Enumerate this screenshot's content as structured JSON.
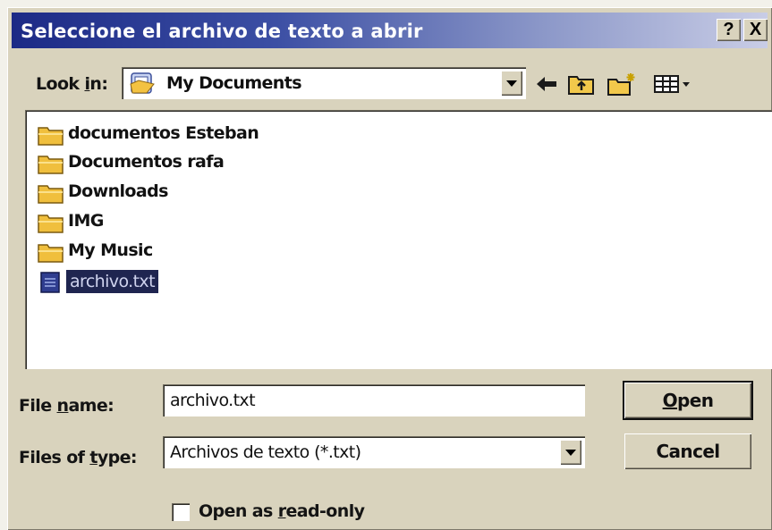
{
  "window": {
    "title": "Seleccione el archivo de texto a abrir",
    "help_button": "?",
    "close_button": "X"
  },
  "look_in": {
    "label_prefix": "Look ",
    "label_accel": "i",
    "label_suffix": "n:",
    "value": "My Documents",
    "icon": "my-documents-icon"
  },
  "toolbar": {
    "icons": [
      "back-arrow-icon",
      "up-folder-icon",
      "new-folder-icon",
      "view-menu-icon"
    ]
  },
  "files": [
    {
      "name": "documentos Esteban",
      "icon": "folder-icon"
    },
    {
      "name": "Documentos rafa",
      "icon": "folder-icon"
    },
    {
      "name": "Downloads",
      "icon": "folder-icon"
    },
    {
      "name": "IMG",
      "icon": "folder-icon"
    },
    {
      "name": "My Music",
      "icon": "folder-icon"
    },
    {
      "name": "archivo.txt",
      "icon": "text-file-icon",
      "selected": true
    }
  ],
  "file_name": {
    "label_prefix": "File ",
    "label_accel": "n",
    "label_suffix": "ame:",
    "value": "archivo.txt"
  },
  "file_type": {
    "label_prefix": "Files of ",
    "label_accel": "t",
    "label_suffix": "ype:",
    "value": "Archivos de texto (*.txt)"
  },
  "buttons": {
    "open_accel": "O",
    "open_rest": "pen",
    "cancel": "Cancel"
  },
  "read_only": {
    "prefix": "Open as ",
    "accel": "r",
    "suffix": "ead-only",
    "checked": false
  },
  "colors": {
    "titlebar_start": "#1c2a86",
    "dialog_face": "#d9d3bd",
    "selection": "#1f2550"
  }
}
